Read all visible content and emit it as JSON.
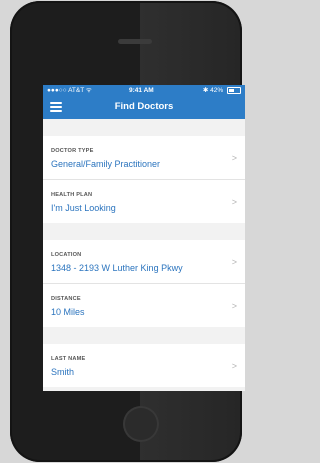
{
  "status": {
    "carrier": "●●●○○ AT&T ᯤ",
    "time": "9:41 AM",
    "battery": "✱ 42%"
  },
  "header": {
    "title": "Find Doctors"
  },
  "rows": [
    {
      "label": "DOCTOR TYPE",
      "value": "General/Family Practitioner"
    },
    {
      "label": "HEALTH PLAN",
      "value": "I'm Just Looking"
    },
    {
      "label": "LOCATION",
      "value": "1348 - 2193 W Luther King Pkwy"
    },
    {
      "label": "DISTANCE",
      "value": "10 Miles"
    },
    {
      "label": "LAST NAME",
      "value": "Smith"
    }
  ],
  "colors": {
    "accent": "#2d7dc7",
    "link": "#2b74be"
  }
}
